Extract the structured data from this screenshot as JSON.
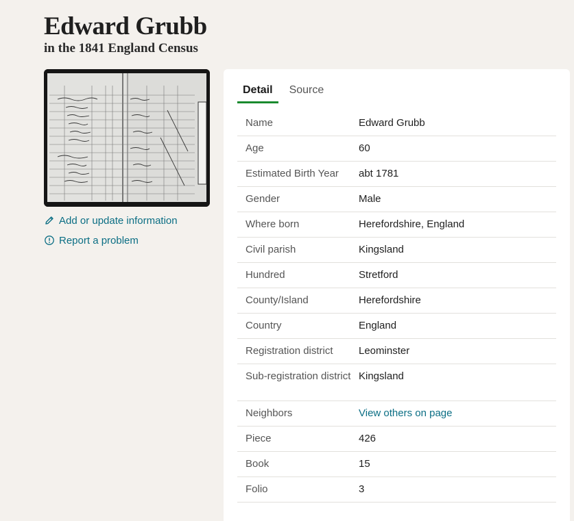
{
  "header": {
    "title": "Edward Grubb",
    "subtitle": "in the 1841 England Census"
  },
  "side_links": {
    "edit_label": "Add or update information",
    "report_label": "Report a problem"
  },
  "tabs": [
    {
      "label": "Detail",
      "active": true
    },
    {
      "label": "Source",
      "active": false
    }
  ],
  "details": [
    {
      "label": "Name",
      "value": "Edward Grubb"
    },
    {
      "label": "Age",
      "value": "60"
    },
    {
      "label": "Estimated Birth Year",
      "value": "abt 1781"
    },
    {
      "label": "Gender",
      "value": "Male"
    },
    {
      "label": "Where born",
      "value": "Herefordshire, England"
    },
    {
      "label": "Civil parish",
      "value": "Kingsland"
    },
    {
      "label": "Hundred",
      "value": "Stretford"
    },
    {
      "label": "County/Island",
      "value": "Herefordshire"
    },
    {
      "label": "Country",
      "value": "England"
    },
    {
      "label": "Registration district",
      "value": "Leominster"
    },
    {
      "label": "Sub-registration district",
      "value": "Kingsland"
    },
    {
      "label": "Neighbors",
      "value": "View others on page"
    },
    {
      "label": "Piece",
      "value": "426"
    },
    {
      "label": "Book",
      "value": "15"
    },
    {
      "label": "Folio",
      "value": "3"
    }
  ],
  "colors": {
    "background": "#f4f1ed",
    "link": "#0b6e84",
    "active_tab_underline": "#1a8a2e"
  },
  "icons": {
    "edit": "pencil-icon",
    "report": "info-circle-icon"
  }
}
